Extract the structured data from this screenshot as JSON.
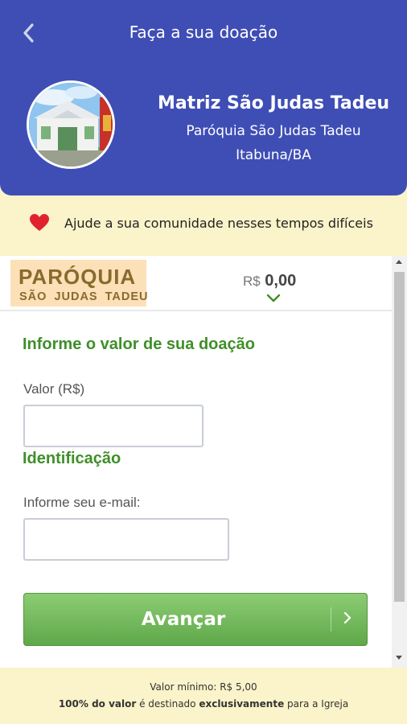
{
  "header": {
    "title": "Faça a sua doação",
    "back_icon": "chevron-left-icon",
    "church_name": "Matriz São Judas Tadeu",
    "parish": "Paróquia São Judas Tadeu",
    "city": "Itabuna/BA"
  },
  "help": {
    "icon": "heart-icon",
    "text": "Ajude a sua comunidade nesses tempos difíceis"
  },
  "summary": {
    "logo_main": "PARÓQUIA",
    "logo_sub": "SÃO JUDAS TADEU",
    "currency": "R$",
    "amount": "0,00"
  },
  "form": {
    "donation_title": "Informe o valor de sua doação",
    "value_label": "Valor (R$)",
    "value_input": "",
    "identification_title": "Identificação",
    "email_label": "Informe seu e-mail:",
    "email_input": "",
    "submit_label": "Avançar"
  },
  "footer": {
    "min_value": "Valor mínimo: R$ 5,00",
    "dest_bold1": "100% do valor",
    "dest_mid": " é destinado ",
    "dest_bold2": "exclusivamente",
    "dest_end": " para a Igreja"
  },
  "colors": {
    "header_bg": "#3f4eb5",
    "banner_bg": "#fbf3c9",
    "accent_green": "#3f8f2a",
    "button_green": "#6cb553",
    "heart_red": "#e0242f"
  }
}
